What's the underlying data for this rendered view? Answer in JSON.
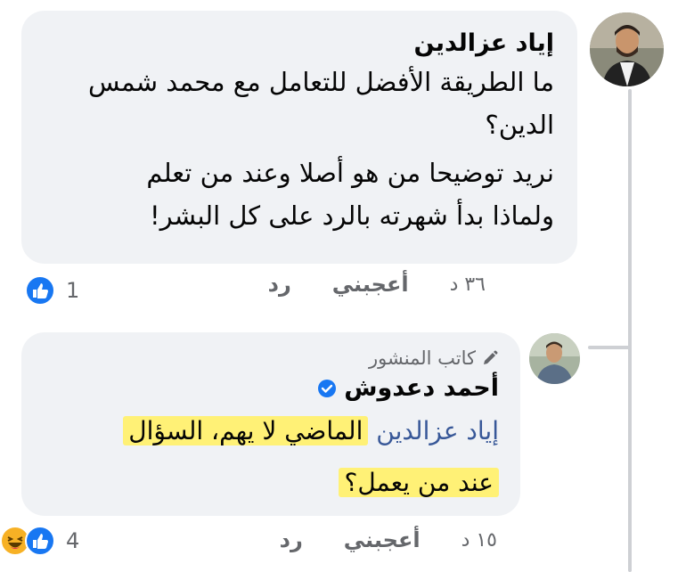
{
  "comment": {
    "author": "إياد عزالدين",
    "text_lines": [
      "ما الطريقة الأفضل للتعامل مع محمد شمس",
      "الدين؟"
    ],
    "text2_lines": [
      "نريد توضيحا من هو أصلا وعند من تعلم",
      "ولماذا بدأ شهرته بالرد على كل البشر!"
    ],
    "time": "٣٦ د",
    "like_label": "أعجبني",
    "reply_label": "رد",
    "reaction_count": "1",
    "reactions": [
      "like-icon"
    ]
  },
  "reply": {
    "badge": "كاتب المنشور",
    "author": "أحمد دعدوش",
    "mention": "إياد عزالدين",
    "text_line1": "الماضي لا يهم، السؤال",
    "text_line2": "عند من يعمل؟",
    "time": "١٥ د",
    "like_label": "أعجبني",
    "reply_label": "رد",
    "reaction_count": "4",
    "reactions": [
      "haha-icon",
      "like-icon"
    ],
    "highlight_color": "#fff176"
  },
  "colors": {
    "bubble": "#f0f2f5",
    "link": "#385898",
    "like_blue": "#1877f2",
    "muted": "#65676b"
  }
}
